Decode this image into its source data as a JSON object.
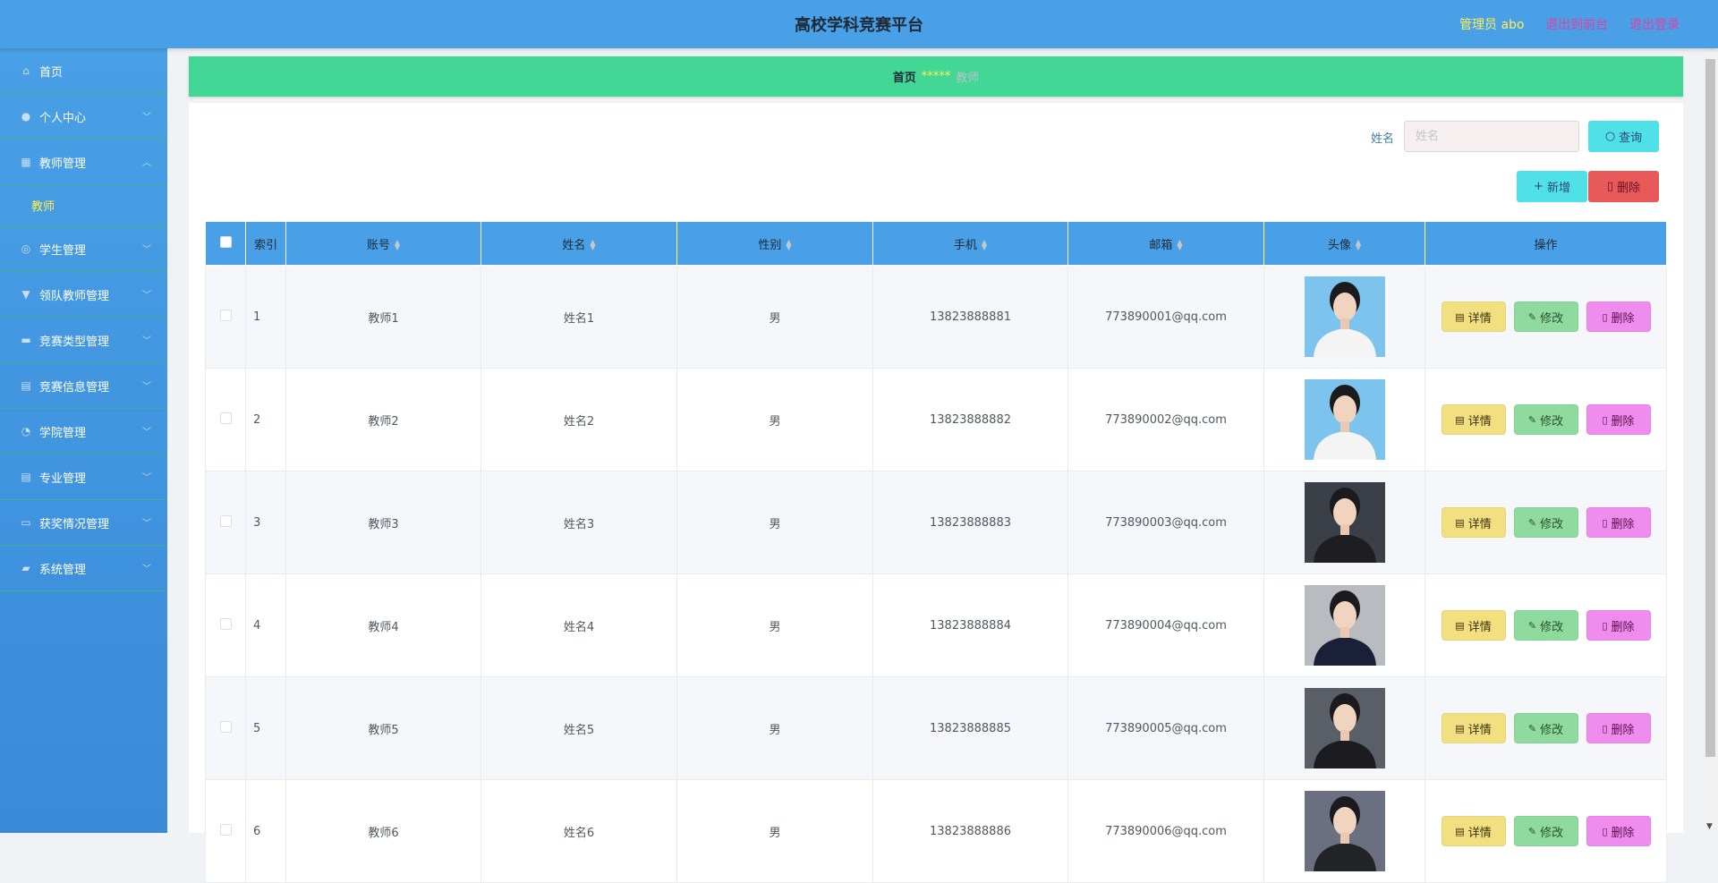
{
  "header": {
    "title": "高校学科竞赛平台",
    "admin": "管理员 abo",
    "link_front": "退出到前台",
    "link_logout": "退出登录"
  },
  "sidebar": {
    "items": [
      {
        "label": "首页",
        "icon": "home-icon"
      },
      {
        "label": "个人中心",
        "icon": "user-icon"
      },
      {
        "label": "教师管理",
        "icon": "grid-icon"
      },
      {
        "label": "学生管理",
        "icon": "compass-icon"
      },
      {
        "label": "领队教师管理",
        "icon": "cup-icon"
      },
      {
        "label": "竞赛类型管理",
        "icon": "briefcase-icon"
      },
      {
        "label": "竞赛信息管理",
        "icon": "clipboard-icon"
      },
      {
        "label": "学院管理",
        "icon": "gauge-icon"
      },
      {
        "label": "专业管理",
        "icon": "clipboard-icon"
      },
      {
        "label": "获奖情况管理",
        "icon": "ticket-icon"
      },
      {
        "label": "系统管理",
        "icon": "chat-icon"
      }
    ],
    "sub_item": "教师"
  },
  "breadcrumb": {
    "home": "首页",
    "stars": "*****",
    "current": "教师"
  },
  "search": {
    "label": "姓名",
    "placeholder": "姓名",
    "query_button": "查询"
  },
  "toolbar": {
    "add_button": "新增",
    "delete_button": "删除"
  },
  "table": {
    "headers": {
      "index": "索引",
      "account": "账号",
      "name": "姓名",
      "gender": "性别",
      "phone": "手机",
      "email": "邮箱",
      "avatar": "头像",
      "actions": "操作"
    },
    "actions": {
      "detail": "详情",
      "edit": "修改",
      "delete": "删除"
    },
    "rows": [
      {
        "index": "1",
        "account": "教师1",
        "name": "姓名1",
        "gender": "男",
        "phone": "13823888881",
        "email": "773890001@qq.com"
      },
      {
        "index": "2",
        "account": "教师2",
        "name": "姓名2",
        "gender": "男",
        "phone": "13823888882",
        "email": "773890002@qq.com"
      },
      {
        "index": "3",
        "account": "教师3",
        "name": "姓名3",
        "gender": "男",
        "phone": "13823888883",
        "email": "773890003@qq.com"
      },
      {
        "index": "4",
        "account": "教师4",
        "name": "姓名4",
        "gender": "男",
        "phone": "13823888884",
        "email": "773890004@qq.com"
      },
      {
        "index": "5",
        "account": "教师5",
        "name": "姓名5",
        "gender": "男",
        "phone": "13823888885",
        "email": "773890005@qq.com"
      },
      {
        "index": "6",
        "account": "教师6",
        "name": "姓名6",
        "gender": "男",
        "phone": "13823888886",
        "email": "773890006@qq.com"
      }
    ]
  },
  "colors": {
    "header_bg": "#49a0e6",
    "breadcrumb_bg": "#43d796",
    "accent_yellow": "#ffee58",
    "link_pink": "#e040a0"
  }
}
